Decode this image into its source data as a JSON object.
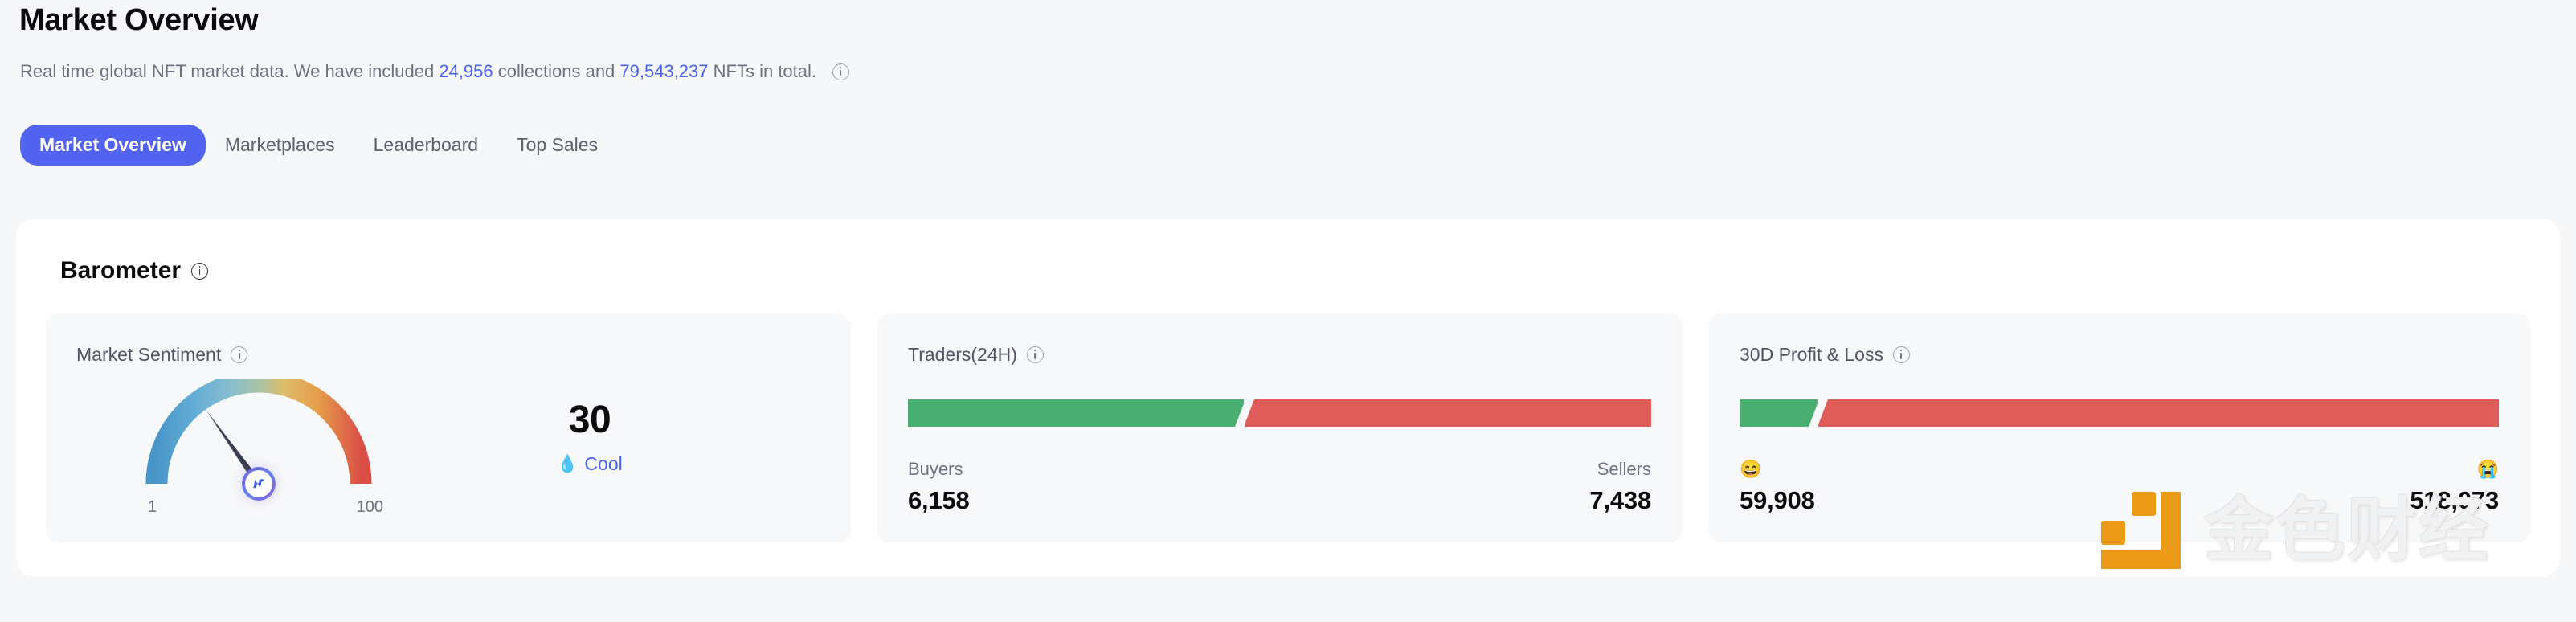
{
  "header": {
    "title": "Market Overview",
    "subtitle_pre": "Real time global NFT market data. We have included ",
    "collections_count": "24,956",
    "subtitle_mid": " collections and ",
    "nfts_count": "79,543,237",
    "subtitle_post": " NFTs in total.",
    "info_icon": "info-icon"
  },
  "tabs": [
    {
      "label": "Market Overview",
      "active": true
    },
    {
      "label": "Marketplaces",
      "active": false
    },
    {
      "label": "Leaderboard",
      "active": false
    },
    {
      "label": "Top Sales",
      "active": false
    }
  ],
  "panel": {
    "title": "Barometer",
    "info_icon": "info-icon"
  },
  "cards": {
    "market_sentiment": {
      "title": "Market Sentiment",
      "info_icon": "info-icon",
      "score": "30",
      "mood_emoji": "💧",
      "mood_label": "Cool",
      "scale_min": "1",
      "scale_max": "100",
      "hub_icon": "nftgo-n-logo-icon"
    },
    "traders_24h": {
      "title": "Traders(24H)",
      "info_icon": "info-icon",
      "left_label": "Buyers",
      "left_value": "6,158",
      "right_label": "Sellers",
      "right_value": "7,438"
    },
    "profit_loss_30d": {
      "title": "30D Profit & Loss",
      "info_icon": "info-icon",
      "left_label": "😄",
      "left_value": "59,908",
      "right_label": "😭",
      "right_value": "518,073"
    }
  },
  "watermark": {
    "text": "金色财经",
    "logo_icon": "jinse-finance-logo-icon",
    "logo_color": "#eb9a18"
  },
  "colors": {
    "accent": "#5163f0",
    "link": "#4a62f0",
    "green": "#4caf72",
    "red": "#e05c58",
    "page_bg": "#f6f7f9",
    "panel_bg": "#ffffff",
    "card_bg": "#f7f8f9",
    "text_muted": "#6b7280",
    "needle": "#3d4258"
  },
  "chart_data": [
    {
      "type": "gauge",
      "title": "Market Sentiment",
      "value": 30,
      "range": [
        1,
        100
      ],
      "label": "Cool",
      "tick_labels": [
        "1",
        "100"
      ],
      "gradient_stops": [
        "#4a9ed1",
        "#7ab7d8",
        "#9dc2b9",
        "#dcbb68",
        "#e6a14f",
        "#d9534f"
      ]
    },
    {
      "type": "bar",
      "subtype": "horizontal-stacked",
      "title": "Traders(24H)",
      "categories": [
        "Buyers",
        "Sellers"
      ],
      "values": [
        6158,
        7438
      ],
      "percent": [
        45.3,
        54.7
      ],
      "colors": [
        "#4caf72",
        "#e05c58"
      ],
      "grid": false,
      "legend": "inline-below"
    },
    {
      "type": "bar",
      "subtype": "horizontal-stacked",
      "title": "30D Profit & Loss",
      "categories": [
        "Profit",
        "Loss"
      ],
      "values": [
        59908,
        518073
      ],
      "percent": [
        10.4,
        89.6
      ],
      "colors": [
        "#4caf72",
        "#e05c58"
      ],
      "grid": false,
      "legend": "inline-below"
    }
  ]
}
